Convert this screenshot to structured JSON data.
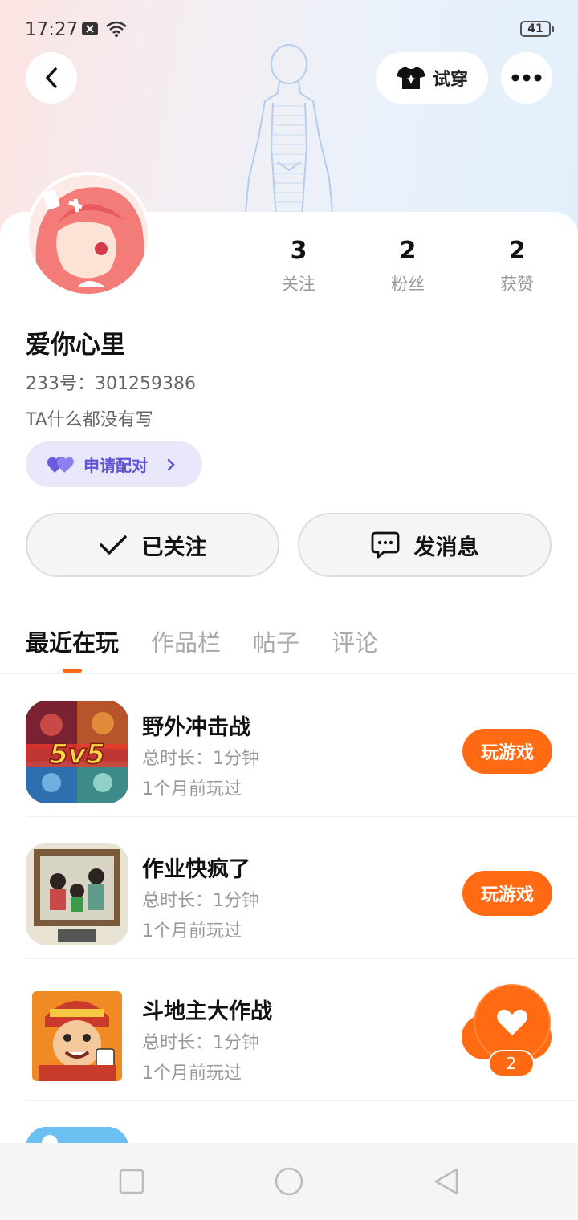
{
  "status_bar": {
    "time": "17:27",
    "battery": "41"
  },
  "header": {
    "try_on_label": "试穿"
  },
  "profile": {
    "stats": [
      {
        "value": "3",
        "label": "关注"
      },
      {
        "value": "2",
        "label": "粉丝"
      },
      {
        "value": "2",
        "label": "获赞"
      }
    ],
    "name": "爱你心里",
    "id_text": "233号：301259386",
    "bio": "TA什么都没有写",
    "pair_label": "申请配对",
    "follow_label": "已关注",
    "message_label": "发消息"
  },
  "tabs": [
    {
      "label": "最近在玩",
      "active": true
    },
    {
      "label": "作品栏",
      "active": false
    },
    {
      "label": "帖子",
      "active": false
    },
    {
      "label": "评论",
      "active": false
    }
  ],
  "games": [
    {
      "title": "野外冲击战",
      "duration": "总时长：1分钟",
      "last_played": "1个月前玩过",
      "button": "玩游戏",
      "icon_text": "5v5"
    },
    {
      "title": "作业快疯了",
      "duration": "总时长：1分钟",
      "last_played": "1个月前玩过",
      "button": "玩游戏"
    },
    {
      "title": "斗地主大作战",
      "duration": "总时长：1分钟",
      "last_played": "1个月前玩过"
    }
  ],
  "like": {
    "count": "2"
  },
  "colors": {
    "accent": "#ff6a13",
    "pair_purple": "#6055d6"
  }
}
